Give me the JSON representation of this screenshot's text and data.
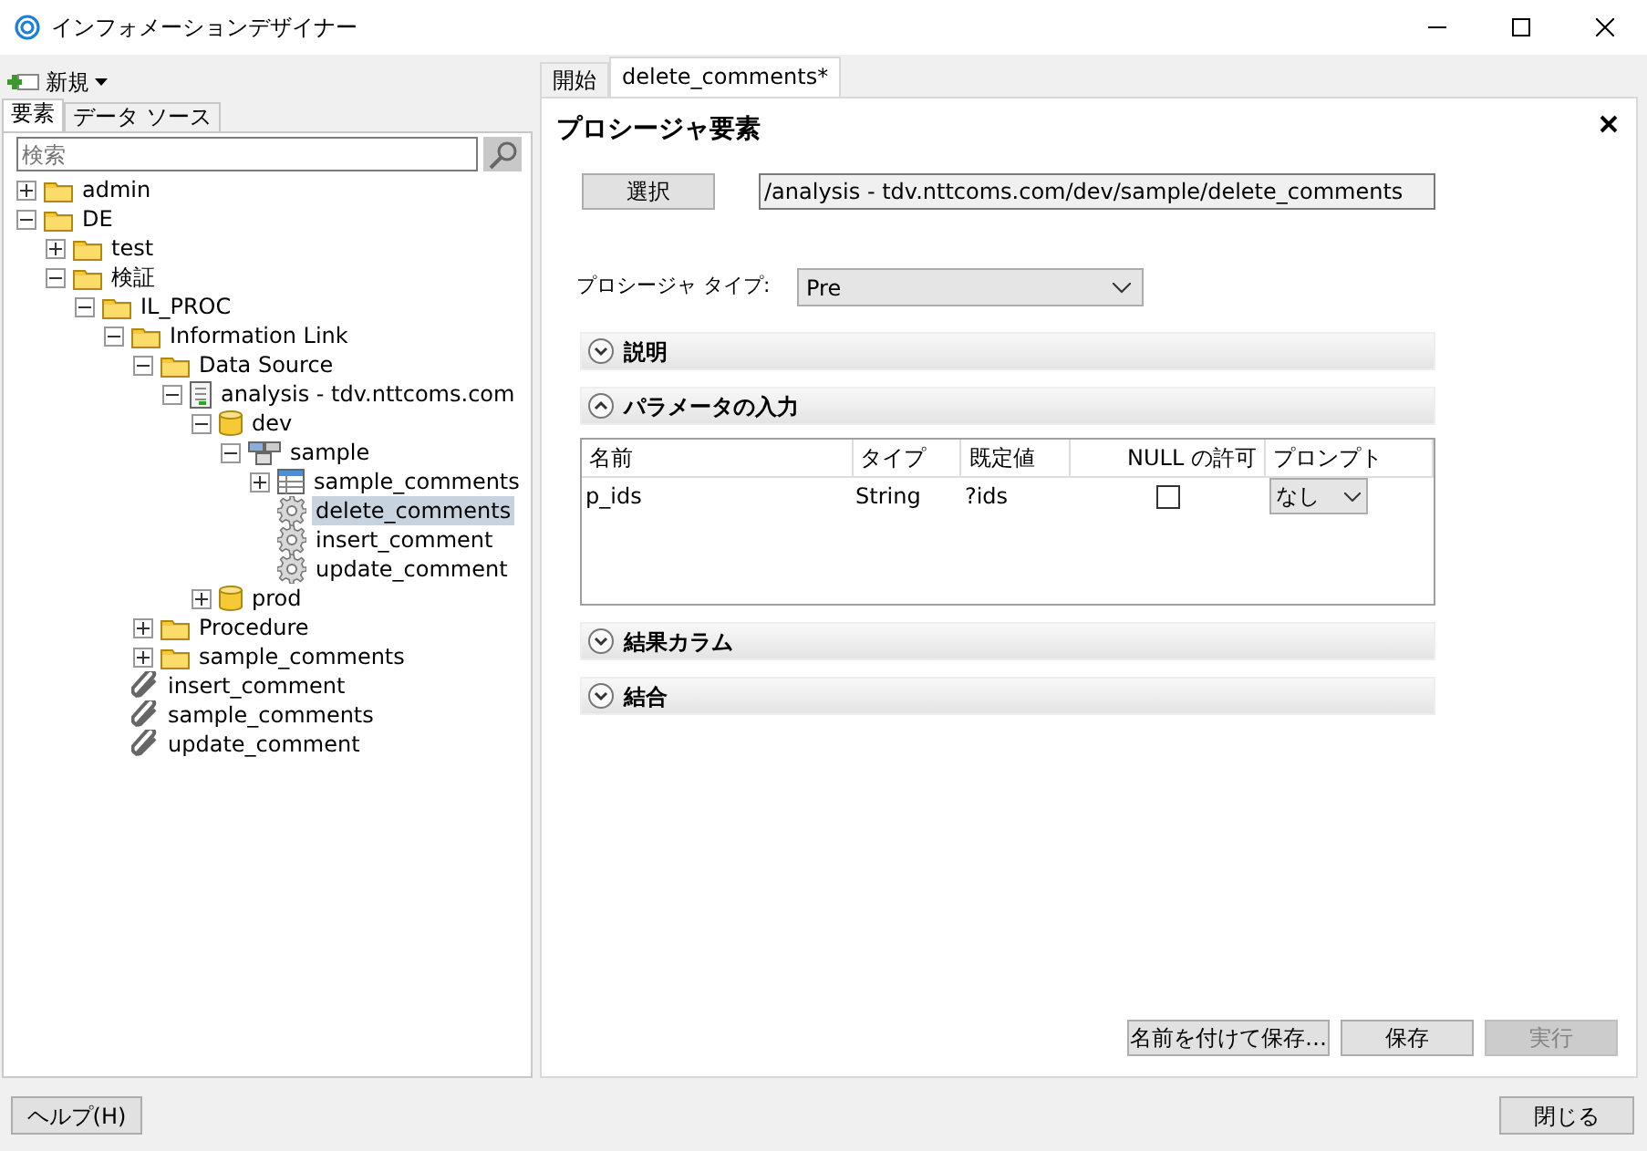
{
  "window": {
    "title": "インフォメーションデザイナー"
  },
  "new_button": {
    "label": "新規"
  },
  "left_tabs": [
    {
      "label": "要素",
      "selected": true
    },
    {
      "label": "データ ソース",
      "selected": false
    }
  ],
  "search": {
    "placeholder": "検索"
  },
  "tree": [
    {
      "label": "admin",
      "kind": "folder",
      "expanded": false,
      "selected": false
    },
    {
      "label": "DE",
      "kind": "folder",
      "expanded": true,
      "selected": false,
      "children": [
        {
          "label": "test",
          "kind": "folder",
          "expanded": false,
          "selected": false
        },
        {
          "label": "検証",
          "kind": "folder",
          "expanded": true,
          "selected": false,
          "children": [
            {
              "label": "IL_PROC",
              "kind": "folder",
              "expanded": true,
              "selected": false,
              "children": [
                {
                  "label": "Information Link",
                  "kind": "folder",
                  "expanded": true,
                  "selected": false,
                  "children": [
                    {
                      "label": "Data Source",
                      "kind": "folder",
                      "expanded": true,
                      "selected": false,
                      "children": [
                        {
                          "label": "analysis - tdv.nttcoms.com",
                          "kind": "datasource",
                          "expanded": true,
                          "selected": false,
                          "children": [
                            {
                              "label": "dev",
                              "kind": "database",
                              "expanded": true,
                              "selected": false,
                              "children": [
                                {
                                  "label": "sample",
                                  "kind": "schema",
                                  "expanded": true,
                                  "selected": false,
                                  "children": [
                                    {
                                      "label": "sample_comments",
                                      "kind": "table",
                                      "expanded": false,
                                      "selected": false
                                    },
                                    {
                                      "label": "delete_comments",
                                      "kind": "procedure",
                                      "selected": true
                                    },
                                    {
                                      "label": "insert_comment",
                                      "kind": "procedure",
                                      "selected": false
                                    },
                                    {
                                      "label": "update_comment",
                                      "kind": "procedure",
                                      "selected": false
                                    }
                                  ]
                                }
                              ]
                            },
                            {
                              "label": "prod",
                              "kind": "database",
                              "expanded": false,
                              "selected": false
                            }
                          ]
                        }
                      ]
                    },
                    {
                      "label": "Procedure",
                      "kind": "folder",
                      "expanded": false,
                      "selected": false
                    },
                    {
                      "label": "sample_comments",
                      "kind": "folder",
                      "expanded": false,
                      "selected": false
                    }
                  ]
                },
                {
                  "label": "insert_comment",
                  "kind": "link",
                  "selected": false
                },
                {
                  "label": "sample_comments",
                  "kind": "link",
                  "selected": false
                },
                {
                  "label": "update_comment",
                  "kind": "link",
                  "selected": false
                }
              ]
            }
          ]
        }
      ]
    }
  ],
  "editor_tabs": [
    {
      "label": "開始",
      "selected": false
    },
    {
      "label": "delete_comments*",
      "selected": true
    }
  ],
  "panel": {
    "title": "プロシージャ要素",
    "select_button": "選択",
    "path": "/analysis - tdv.nttcoms.com/dev/sample/delete_comments",
    "type_label": "プロシージャ タイプ:",
    "type_value": "Pre",
    "sections": [
      {
        "title": "説明",
        "expanded": false
      },
      {
        "title": "パラメータの入力",
        "expanded": true,
        "table": {
          "columns": [
            "名前",
            "タイプ",
            "既定値",
            "NULL の許可",
            "プロンプト"
          ],
          "rows": [
            {
              "name": "p_ids",
              "type": "String",
              "default": "?ids",
              "null_allowed": false,
              "prompt": "なし"
            }
          ]
        }
      },
      {
        "title": "結果カラム",
        "expanded": false
      },
      {
        "title": "結合",
        "expanded": false
      }
    ],
    "buttons": [
      {
        "label": "名前を付けて保存…",
        "disabled": false
      },
      {
        "label": "保存",
        "disabled": false
      },
      {
        "label": "実行",
        "disabled": true
      }
    ]
  },
  "footer": {
    "help_button": "ヘルプ(H)",
    "close_button": "閉じる"
  }
}
